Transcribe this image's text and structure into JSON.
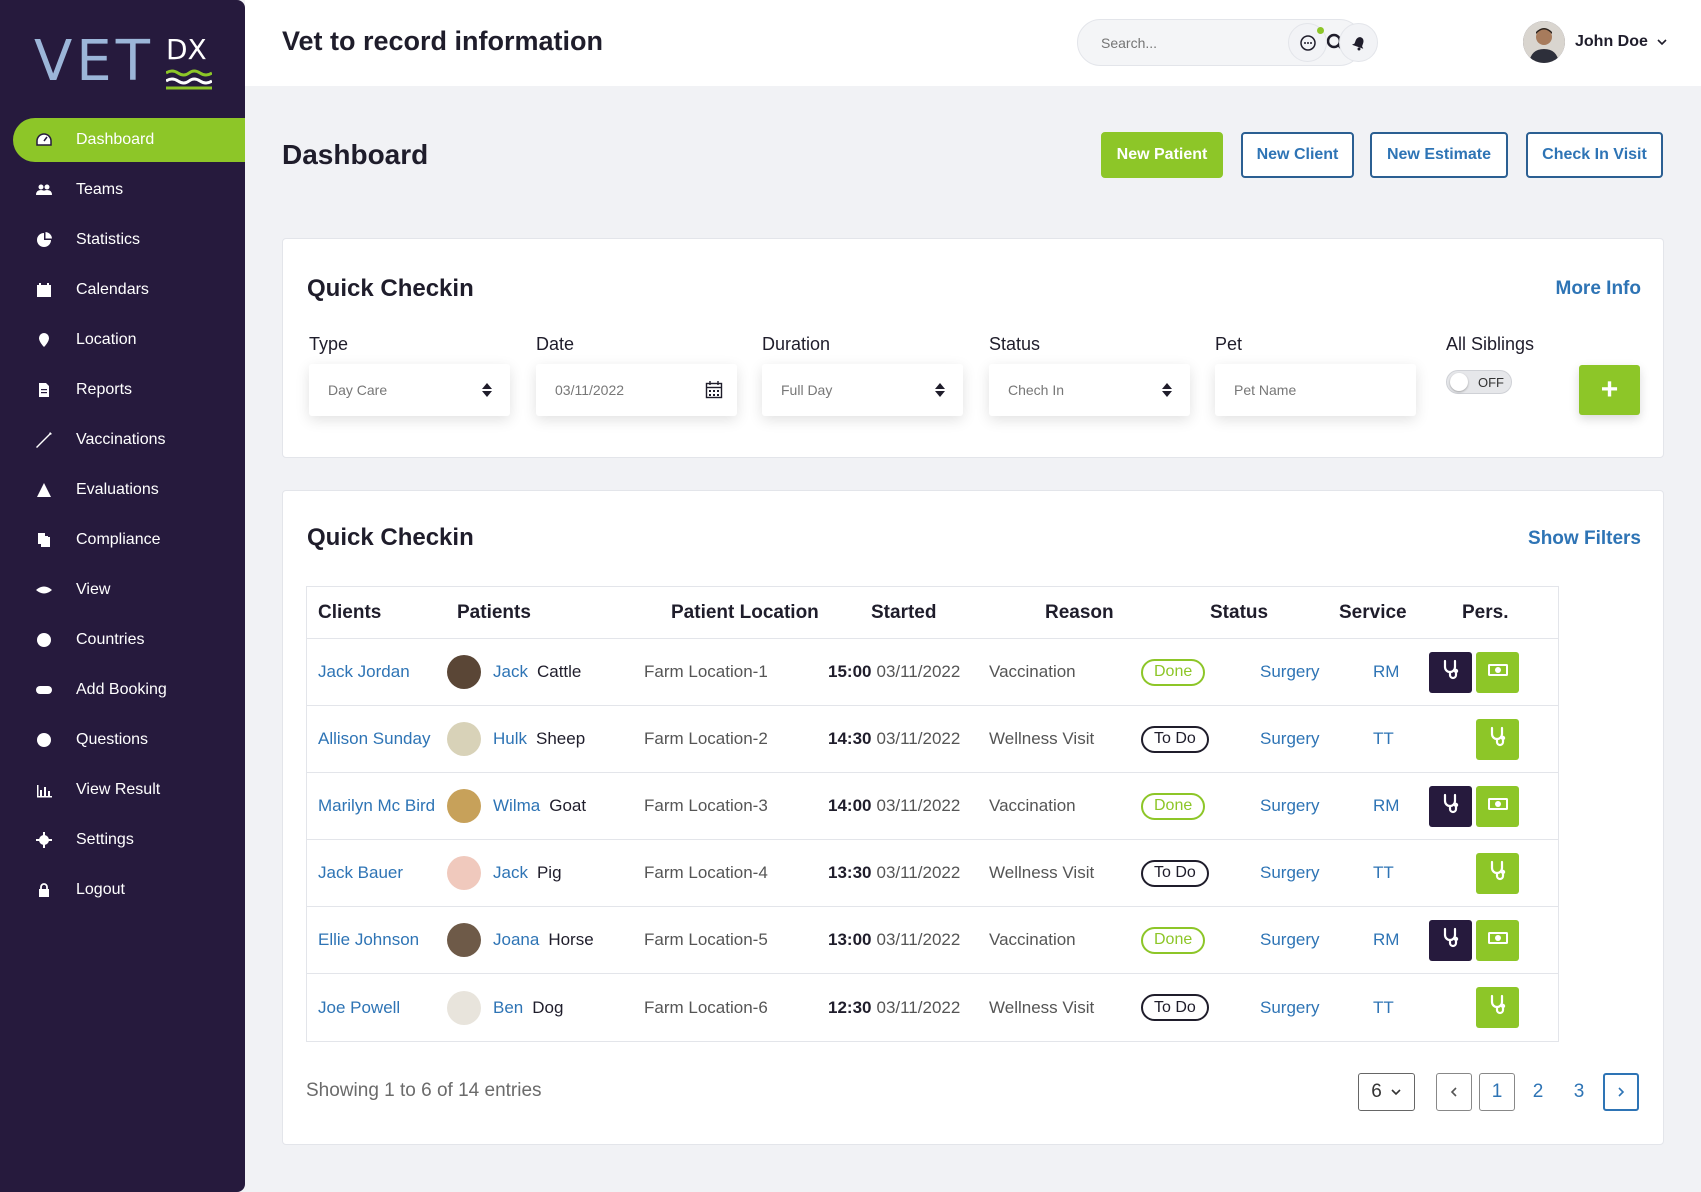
{
  "brand": {
    "logo_text": "VET",
    "logo_suffix": "DX"
  },
  "colors": {
    "accent": "#8dc628",
    "sidebar": "#261a3d",
    "link": "#2e74b5"
  },
  "sidebar": {
    "items": [
      {
        "label": "Dashboard",
        "icon": "dashboard-icon",
        "active": true
      },
      {
        "label": "Teams",
        "icon": "teams-icon"
      },
      {
        "label": "Statistics",
        "icon": "pie-chart-icon"
      },
      {
        "label": "Calendars",
        "icon": "calendar-icon"
      },
      {
        "label": "Location",
        "icon": "map-pin-icon"
      },
      {
        "label": "Reports",
        "icon": "document-icon"
      },
      {
        "label": "Vaccinations",
        "icon": "syringe-icon"
      },
      {
        "label": "Evaluations",
        "icon": "warning-icon"
      },
      {
        "label": "Compliance",
        "icon": "files-icon"
      },
      {
        "label": "View",
        "icon": "eye-icon"
      },
      {
        "label": "Countries",
        "icon": "globe-icon"
      },
      {
        "label": "Add Booking",
        "icon": "gamepad-icon"
      },
      {
        "label": "Questions",
        "icon": "question-icon"
      },
      {
        "label": "View Result",
        "icon": "bar-chart-icon"
      },
      {
        "label": "Settings",
        "icon": "gear-icon"
      },
      {
        "label": "Logout",
        "icon": "lock-icon"
      }
    ]
  },
  "header": {
    "title": "Vet to record information",
    "search_placeholder": "Search...",
    "user_name": "John Doe"
  },
  "dashboard": {
    "title": "Dashboard",
    "buttons": {
      "new_patient": "New Patient",
      "new_client": "New Client",
      "new_estimate": "New Estimate",
      "check_in_visit": "Check In Visit"
    }
  },
  "quick_checkin_form": {
    "title": "Quick Checkin",
    "more_info": "More Info",
    "type_label": "Type",
    "type_value": "Day Care",
    "date_label": "Date",
    "date_value": "03/11/2022",
    "duration_label": "Duration",
    "duration_value": "Full Day",
    "status_label": "Status",
    "status_value": "Chech In",
    "pet_label": "Pet",
    "pet_placeholder": "Pet Name",
    "siblings_label": "All Siblings",
    "siblings_toggle": "OFF",
    "add_label": "+"
  },
  "quick_checkin_table": {
    "title": "Quick Checkin",
    "show_filters": "Show Filters",
    "columns": {
      "clients": "Clients",
      "patients": "Patients",
      "location": "Patient Location",
      "started": "Started",
      "reason": "Reason",
      "status": "Status",
      "service": "Service",
      "pers": "Pers."
    },
    "rows": [
      {
        "client": "Jack Jordan",
        "pet": "Jack",
        "species": "Cattle",
        "location": "Farm Location-1",
        "time": "15:00",
        "date": "03/11/2022",
        "reason": "Vaccination",
        "status": "Done",
        "service": "Surgery",
        "pers": "RM"
      },
      {
        "client": "Allison Sunday",
        "pet": "Hulk",
        "species": "Sheep",
        "location": "Farm Location-2",
        "time": "14:30",
        "date": "03/11/2022",
        "reason": "Wellness Visit",
        "status": "To Do",
        "service": "Surgery",
        "pers": "TT"
      },
      {
        "client": "Marilyn Mc Bird",
        "pet": "Wilma",
        "species": "Goat",
        "location": "Farm Location-3",
        "time": "14:00",
        "date": "03/11/2022",
        "reason": "Vaccination",
        "status": "Done",
        "service": "Surgery",
        "pers": "RM"
      },
      {
        "client": "Jack Bauer",
        "pet": "Jack",
        "species": "Pig",
        "location": "Farm Location-4",
        "time": "13:30",
        "date": "03/11/2022",
        "reason": "Wellness Visit",
        "status": "To Do",
        "service": "Surgery",
        "pers": "TT"
      },
      {
        "client": "Ellie Johnson",
        "pet": "Joana",
        "species": "Horse",
        "location": "Farm Location-5",
        "time": "13:00",
        "date": "03/11/2022",
        "reason": "Vaccination",
        "status": "Done",
        "service": "Surgery",
        "pers": "RM"
      },
      {
        "client": "Joe Powell",
        "pet": "Ben",
        "species": "Dog",
        "location": "Farm Location-6",
        "time": "12:30",
        "date": "03/11/2022",
        "reason": "Wellness Visit",
        "status": "To Do",
        "service": "Surgery",
        "pers": "TT"
      }
    ]
  },
  "pagination": {
    "showing": "Showing 1 to 6 of 14 entries",
    "per_page": "6",
    "pages": [
      "1",
      "2",
      "3"
    ]
  }
}
